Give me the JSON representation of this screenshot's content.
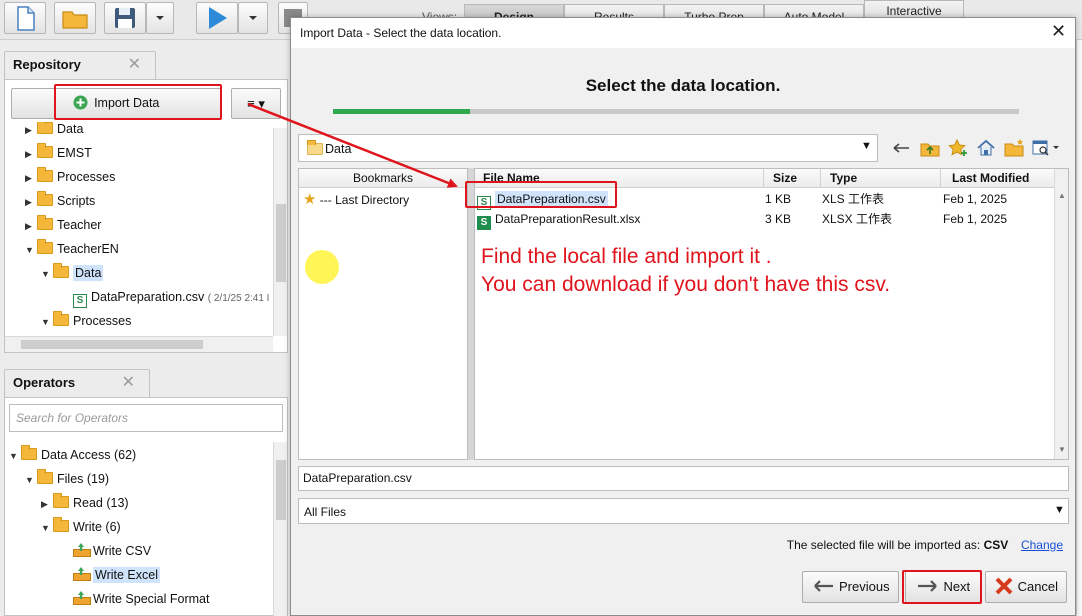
{
  "toolbar": {
    "views_label": "Views:",
    "tabs": [
      "Design",
      "Results",
      "Turbo Prep",
      "Auto Model",
      "Interactive"
    ]
  },
  "repository": {
    "title": "Repository",
    "import_button": "Import Data",
    "tree": [
      {
        "label": "Data",
        "level": 1
      },
      {
        "label": "EMST",
        "level": 1
      },
      {
        "label": "Processes",
        "level": 1
      },
      {
        "label": "Scripts",
        "level": 1
      },
      {
        "label": "Teacher",
        "level": 1
      },
      {
        "label": "TeacherEN",
        "level": 1
      },
      {
        "label": "Data",
        "level": 2
      },
      {
        "label": "DataPreparation.csv",
        "meta": "( 2/1/25 2:41 I",
        "level": 3
      },
      {
        "label": "Processes",
        "level": 2
      }
    ]
  },
  "operators": {
    "title": "Operators",
    "search_placeholder": "Search for Operators",
    "tree": [
      {
        "label": "Data Access (62)"
      },
      {
        "label": "Files (19)"
      },
      {
        "label": "Read (13)"
      },
      {
        "label": "Write (6)"
      },
      {
        "label": "Write CSV"
      },
      {
        "label": "Write Excel"
      },
      {
        "label": "Write Special Format"
      }
    ]
  },
  "dialog": {
    "title": "Import Data - Select the data location.",
    "heading": "Select the data location.",
    "progress": 0.2,
    "path": "Data",
    "bookmarks_header": "Bookmarks",
    "bookmarks": [
      "--- Last Directory"
    ],
    "columns": [
      "File Name",
      "Size",
      "Type",
      "Last Modified"
    ],
    "files": [
      {
        "name": "DataPreparation.csv",
        "size": "1 KB",
        "type": "XLS 工作表",
        "modified": "Feb 1, 2025"
      },
      {
        "name": "DataPreparationResult.xlsx",
        "size": "3 KB",
        "type": "XLSX 工作表",
        "modified": "Feb 1, 2025"
      }
    ],
    "annotation_line1": "Find the local file and import it .",
    "annotation_line2": "You can download if you don't have this csv.",
    "filename_value": "DataPreparation.csv",
    "filter_value": "All Files",
    "import_info": "The selected file will be imported as:",
    "import_format": "CSV",
    "change_link": "Change",
    "previous_button": "Previous",
    "next_button": "Next",
    "cancel_button": "Cancel"
  },
  "colors": {
    "annotation_red": "#e0141c",
    "progress_green": "#2fa84f",
    "selection_blue": "#cfe3fb"
  }
}
